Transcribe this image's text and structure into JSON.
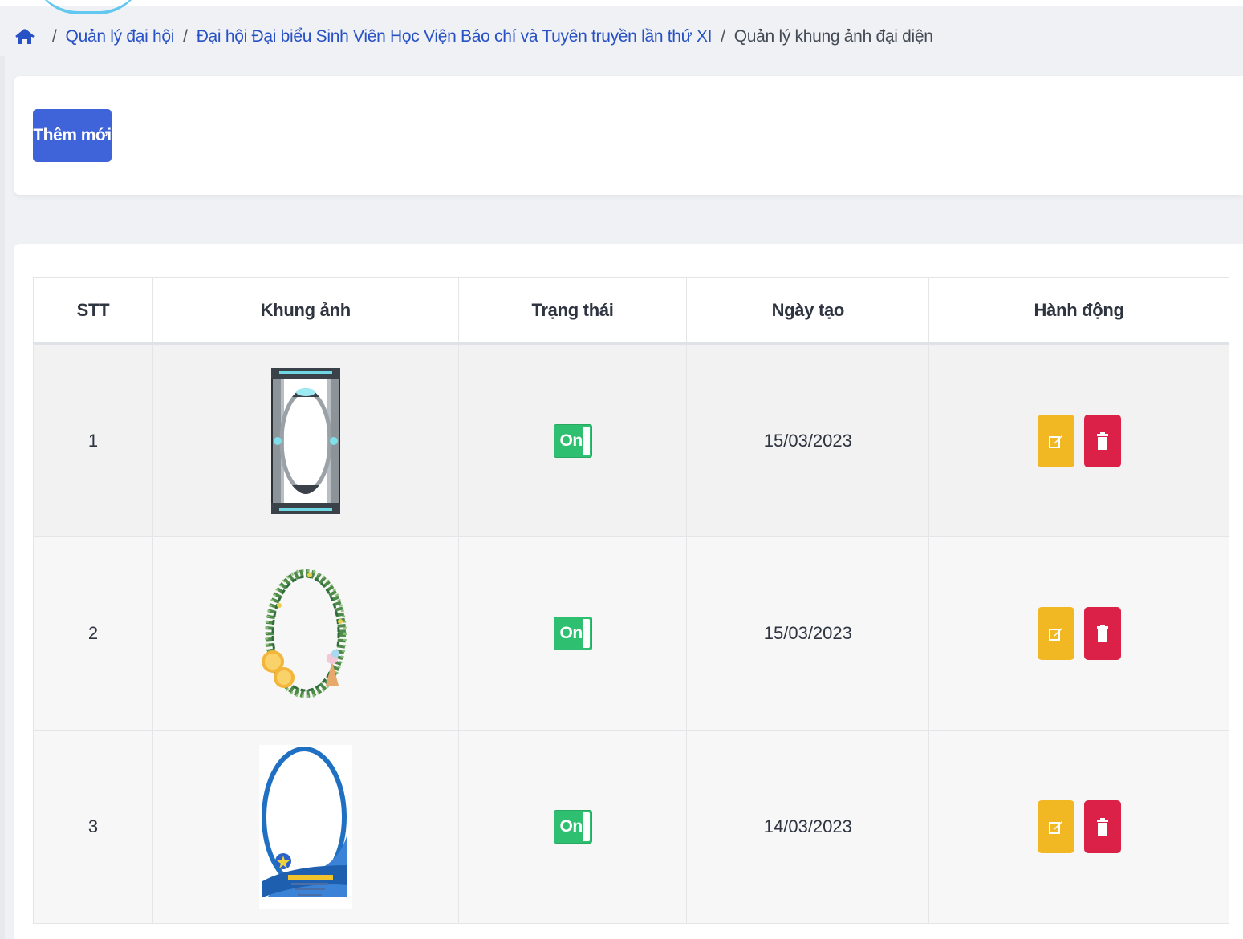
{
  "breadcrumb": {
    "home_icon": "home-icon",
    "items": [
      "Quản lý đại hội",
      "Đại hội Đại biểu Sinh Viên Học Viện Báo chí và Tuyên truyền lần thứ XI"
    ],
    "current": "Quản lý khung ảnh đại diện",
    "separator": "/"
  },
  "toolbar": {
    "add_label": "Thêm mới"
  },
  "table": {
    "headers": [
      "STT",
      "Khung ảnh",
      "Trạng thái",
      "Ngày tạo",
      "Hành động"
    ],
    "rows": [
      {
        "stt": "1",
        "frame": "tech-frame-image",
        "status": "On",
        "created": "15/03/2023"
      },
      {
        "stt": "2",
        "frame": "floral-wreath-frame-image",
        "status": "On",
        "created": "15/03/2023"
      },
      {
        "stt": "3",
        "frame": "blue-circle-frame-image",
        "status": "On",
        "created": "14/03/2023"
      }
    ],
    "action_icons": [
      "edit-icon",
      "trash-icon"
    ]
  },
  "colors": {
    "primary": "#3f63d8",
    "toggle_on": "#2fbf71",
    "edit": "#f2b824",
    "delete": "#dc2149",
    "link": "#2751c4"
  }
}
